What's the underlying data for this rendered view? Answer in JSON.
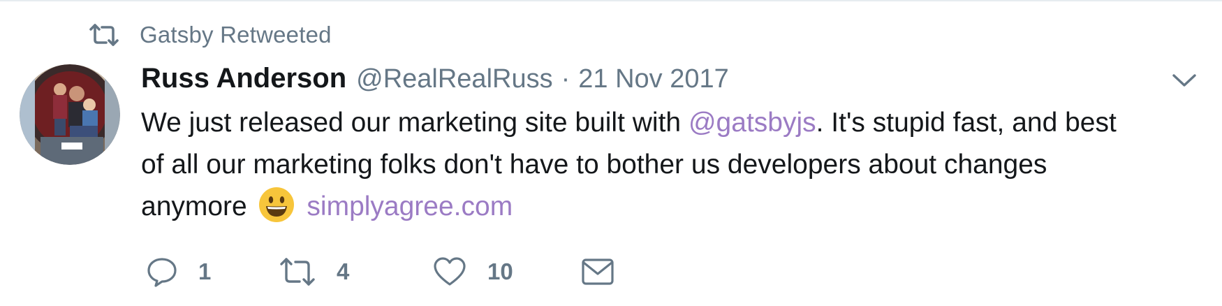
{
  "context": {
    "retweeted_label": "Gatsby Retweeted",
    "icon": "retweet-icon"
  },
  "author": {
    "fullname": "Russ Anderson",
    "username": "@RealRealRuss",
    "separator": "·",
    "timestamp": "21 Nov 2017",
    "avatar_icon": "avatar"
  },
  "tweet": {
    "line1_prefix": "We just released our marketing site built with ",
    "mention": "@gatsbyjs",
    "line1_suffix": ". It's stupid fast, and best",
    "line2": "of all our marketing folks don't have to bother us developers about changes",
    "line3_prefix": "anymore",
    "emoji": "😃",
    "link": "simplyagree.com"
  },
  "actions": {
    "reply_count": "1",
    "retweet_count": "4",
    "like_count": "10",
    "reply_icon": "reply-icon",
    "retweet_icon": "retweet-icon",
    "like_icon": "heart-icon",
    "dm_icon": "envelope-icon",
    "more_icon": "chevron-down-icon"
  },
  "colors": {
    "secondary_text": "#657786",
    "primary_text": "#14171a",
    "link": "#9b7bc4"
  }
}
